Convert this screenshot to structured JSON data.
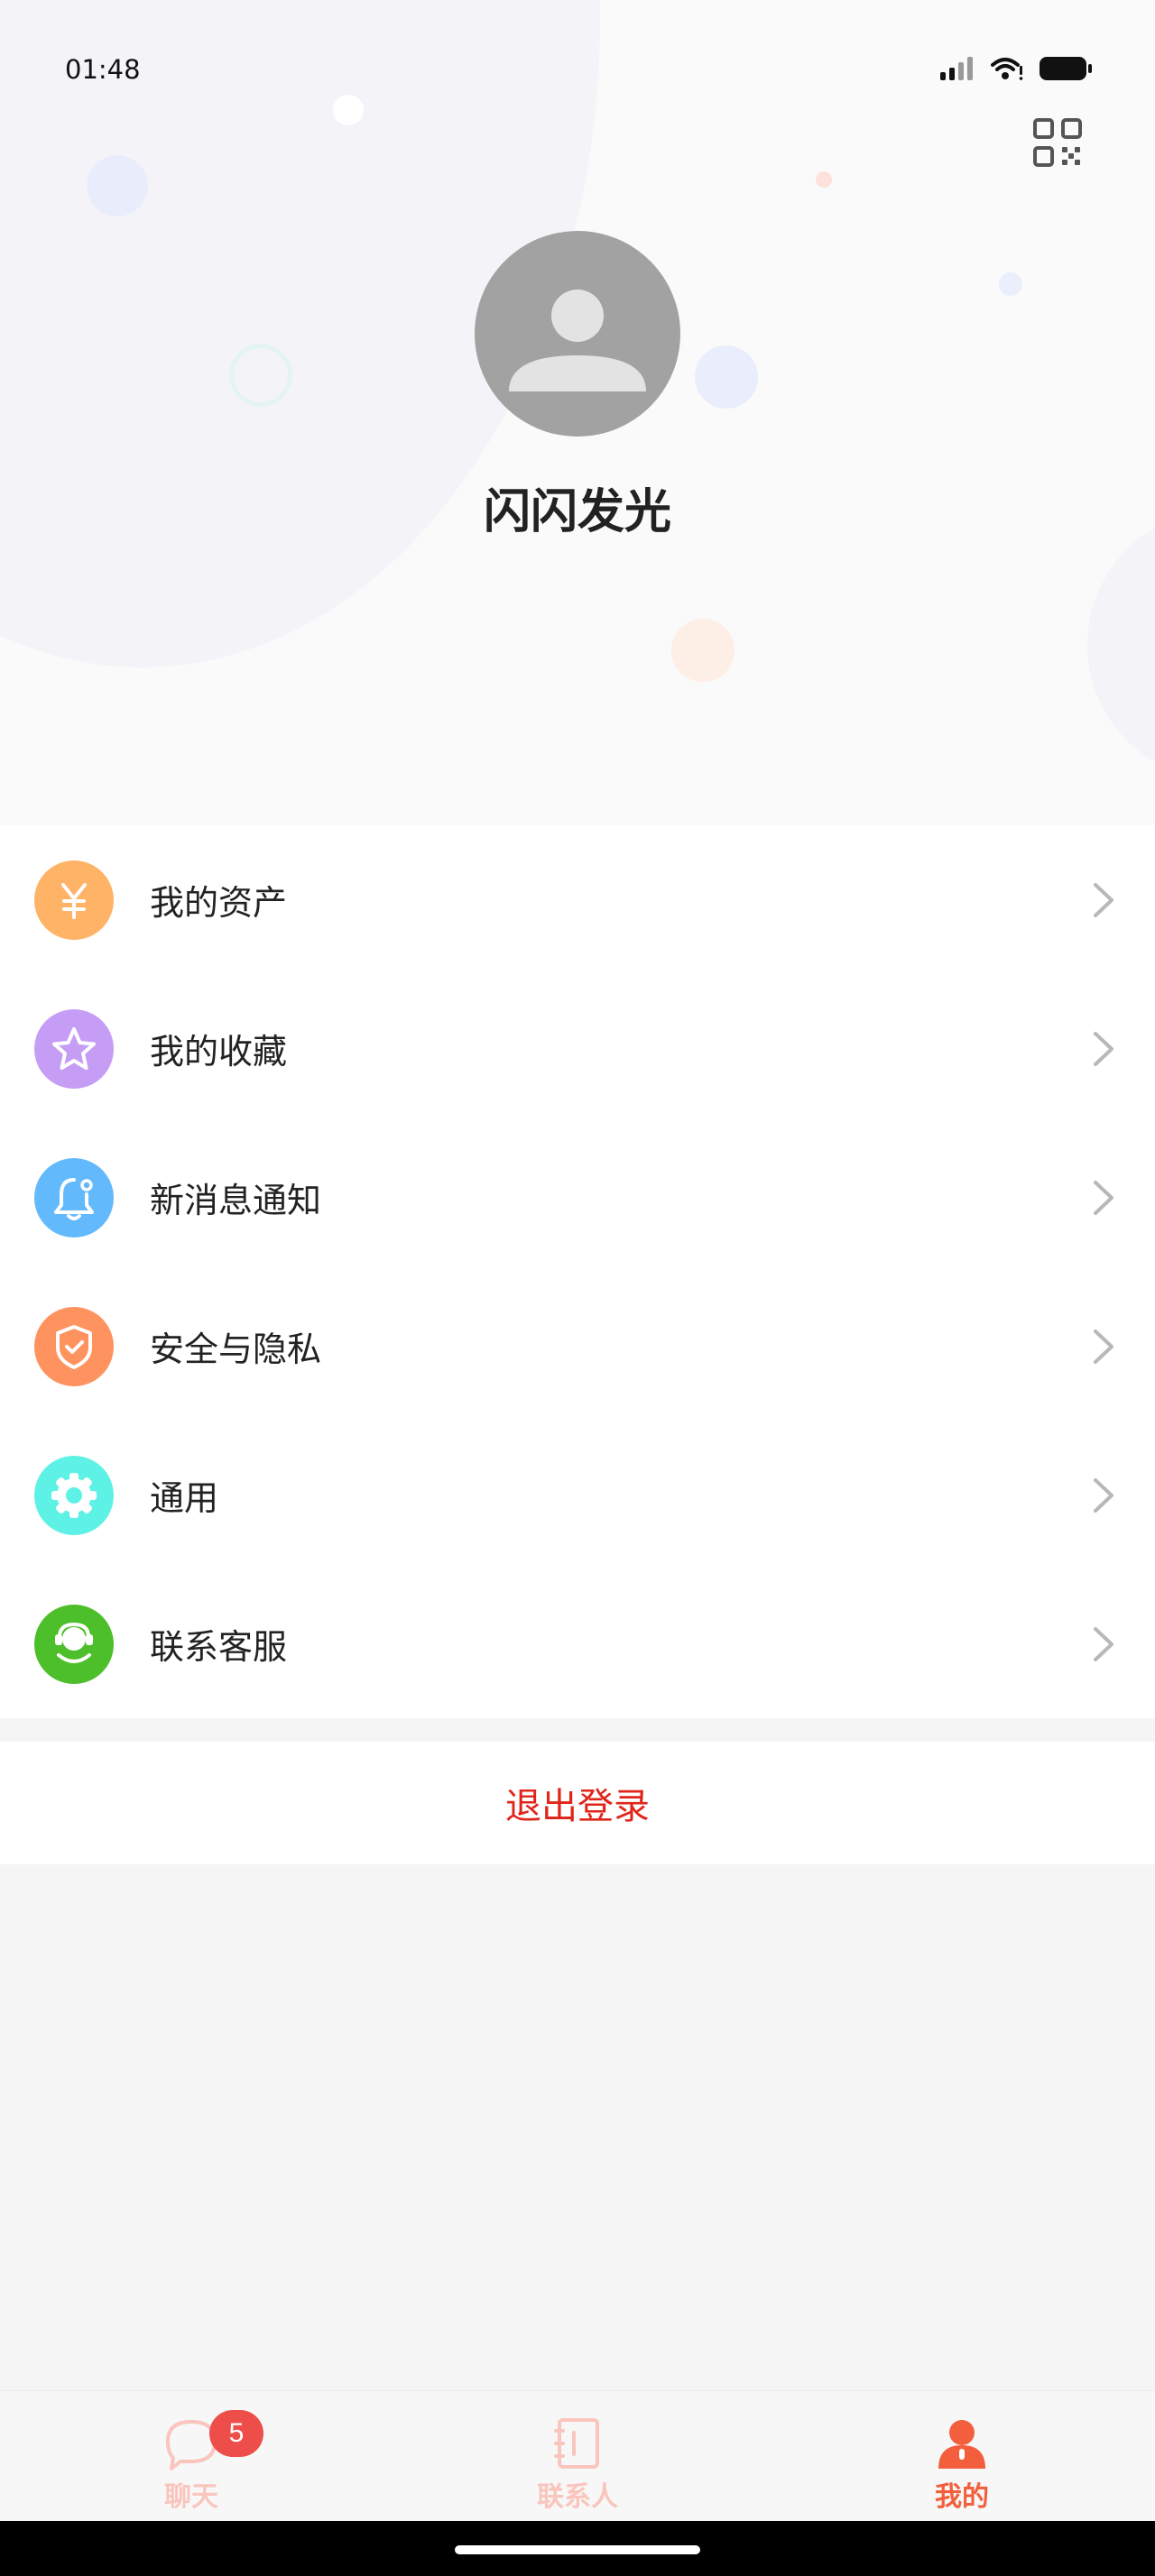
{
  "status_bar": {
    "time": "01:48"
  },
  "profile": {
    "name": "闪闪发光"
  },
  "menu": {
    "items": [
      {
        "label": "我的资产",
        "icon": "yuan-icon",
        "color": "#ffb367"
      },
      {
        "label": "我的收藏",
        "icon": "star-icon",
        "color": "#c69df5"
      },
      {
        "label": "新消息通知",
        "icon": "bell-icon",
        "color": "#62b9fb"
      },
      {
        "label": "安全与隐私",
        "icon": "shield-icon",
        "color": "#fe9360"
      },
      {
        "label": "通用",
        "icon": "gear-icon",
        "color": "#5ef2e6"
      },
      {
        "label": "联系客服",
        "icon": "customer-service-icon",
        "color": "#4cbf2a"
      }
    ]
  },
  "logout": {
    "label": "退出登录",
    "color": "#e0251b"
  },
  "tabbar": {
    "tabs": [
      {
        "label": "聊天",
        "icon": "chat-icon",
        "active": false,
        "badge": "5"
      },
      {
        "label": "联系人",
        "icon": "contacts-icon",
        "active": false
      },
      {
        "label": "我的",
        "icon": "profile-icon",
        "active": true
      }
    ],
    "inactive_color": "#f9c5bc",
    "active_color": "#f35f3d",
    "badge_color": "#ee4e4a"
  }
}
